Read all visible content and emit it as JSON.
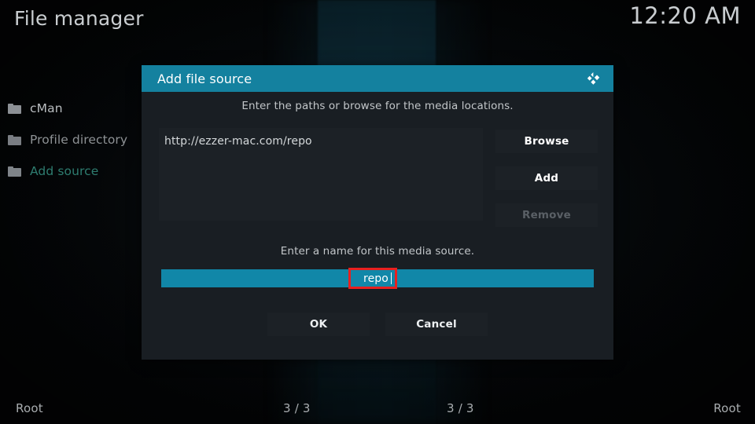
{
  "window": {
    "app_title": "File manager",
    "clock": "12:20 AM"
  },
  "sidebar": {
    "items": [
      {
        "label": "cMan",
        "icon": "folder-icon",
        "state": "normal"
      },
      {
        "label": "Profile directory",
        "icon": "folder-icon",
        "state": "dim"
      },
      {
        "label": "Add source",
        "icon": "folder-icon",
        "state": "accent"
      }
    ]
  },
  "dialog": {
    "title": "Add file source",
    "logo_icon": "kodi-logo-icon",
    "paths_hint": "Enter the paths or browse for the media locations.",
    "paths": [
      "http://ezzer-mac.com/repo"
    ],
    "side_buttons": {
      "browse": "Browse",
      "add": "Add",
      "remove": "Remove"
    },
    "name_hint": "Enter a name for this media source.",
    "name_value": "repo",
    "actions": {
      "ok": "OK",
      "cancel": "Cancel"
    }
  },
  "footer": {
    "left": "Root",
    "center_left": "3 / 3",
    "center_right": "3 / 3",
    "right": "Root"
  },
  "colors": {
    "titlebar_teal": "#14819f",
    "field_teal": "#1187a8",
    "dialog_bg": "#191e23",
    "panel_bg": "#1c2126",
    "accent_green": "#2e7d70",
    "annotation_red": "#e8201f",
    "text_primary": "#d4d8da",
    "text_dim": "#8e9295"
  }
}
